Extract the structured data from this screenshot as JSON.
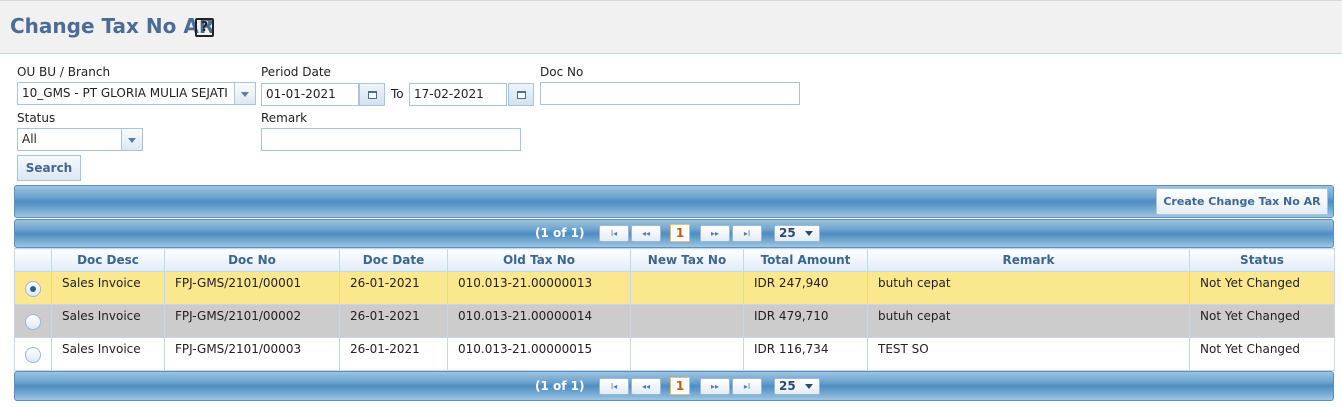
{
  "page": {
    "title": "Change Tax No AR",
    "help_icon": "help-icon"
  },
  "filters": {
    "ou_label": "OU BU / Branch",
    "ou_value": "10_GMS - PT GLORIA MULIA SEJATI",
    "period_label": "Period Date",
    "period_from": "01-01-2021",
    "period_to_label": "To",
    "period_to": "17-02-2021",
    "docno_label": "Doc No",
    "docno_value": "",
    "status_label": "Status",
    "status_value": "All",
    "remark_label": "Remark",
    "remark_value": "",
    "search_label": "Search"
  },
  "toolbar": {
    "create_label": "Create Change Tax No AR"
  },
  "pager": {
    "info": "(1 of 1)",
    "current": "1",
    "page_size": "25"
  },
  "grid": {
    "columns": [
      "Doc Desc",
      "Doc No",
      "Doc Date",
      "Old Tax No",
      "New Tax No",
      "Total Amount",
      "Remark",
      "Status"
    ],
    "rows": [
      {
        "doc_desc": "Sales Invoice",
        "doc_no": "FPJ-GMS/2101/00001",
        "doc_date": "26-01-2021",
        "old_tax_no": "010.013-21.00000013",
        "new_tax_no": "",
        "total_amount": "IDR 247,940",
        "remark": "butuh cepat",
        "status": "Not Yet Changed"
      },
      {
        "doc_desc": "Sales Invoice",
        "doc_no": "FPJ-GMS/2101/00002",
        "doc_date": "26-01-2021",
        "old_tax_no": "010.013-21.00000014",
        "new_tax_no": "",
        "total_amount": "IDR 479,710",
        "remark": "butuh cepat",
        "status": "Not Yet Changed"
      },
      {
        "doc_desc": "Sales Invoice",
        "doc_no": "FPJ-GMS/2101/00003",
        "doc_date": "26-01-2021",
        "old_tax_no": "010.013-21.00000015",
        "new_tax_no": "",
        "total_amount": "IDR 116,734",
        "remark": "TEST SO",
        "status": "Not Yet Changed"
      }
    ]
  },
  "colors": {
    "title": "#4a6c96",
    "selected_row": "#fbe78e",
    "hover_row": "#cccccc",
    "header_text": "#3a6691"
  }
}
